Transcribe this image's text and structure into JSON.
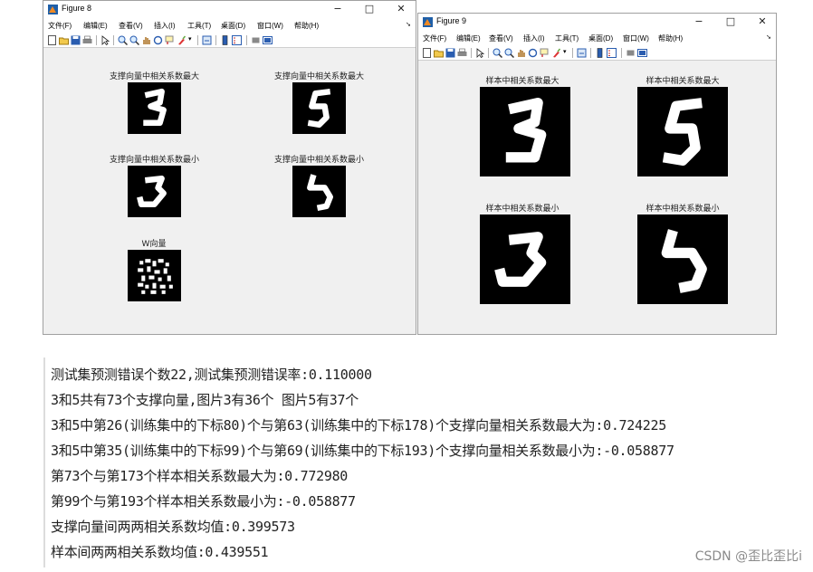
{
  "windows": [
    {
      "title": "Figure 8",
      "controls": [
        "−",
        "□",
        "✕"
      ],
      "menu": [
        "文件(F)",
        "编辑(E)",
        "查看(V)",
        "插入(I)",
        "工具(T)",
        "桌面(D)",
        "窗口(W)",
        "帮助(H)"
      ],
      "subplots": [
        {
          "title": "支撑向量中相关系数最大",
          "digit": "3"
        },
        {
          "title": "支撑向量中相关系数最大",
          "digit": "5"
        },
        {
          "title": "支撑向量中相关系数最小",
          "digit": "3"
        },
        {
          "title": "支撑向量中相关系数最小",
          "digit": "5"
        },
        {
          "title": "W向量",
          "digit": "W"
        }
      ]
    },
    {
      "title": "Figure 9",
      "controls": [
        "−",
        "□",
        "✕"
      ],
      "menu": [
        "文件(F)",
        "编辑(E)",
        "查看(V)",
        "插入(I)",
        "工具(T)",
        "桌面(D)",
        "窗口(W)",
        "帮助(H)"
      ],
      "subplots": [
        {
          "title": "样本中相关系数最大",
          "digit": "3"
        },
        {
          "title": "样本中相关系数最大",
          "digit": "5"
        },
        {
          "title": "样本中相关系数最小",
          "digit": "3"
        },
        {
          "title": "样本中相关系数最小",
          "digit": "5"
        }
      ]
    }
  ],
  "console": {
    "lines": [
      "测试集预测错误个数22,测试集预测错误率:0.110000",
      "3和5共有73个支撑向量,图片3有36个 图片5有37个",
      "3和5中第26(训练集中的下标80)个与第63(训练集中的下标178)个支撑向量相关系数最大为:0.724225",
      "3和5中第35(训练集中的下标99)个与第69(训练集中的下标193)个支撑向量相关系数最小为:-0.058877",
      "第73个与第173个样本相关系数最大为:0.772980",
      "第99个与第193个样本相关系数最小为:-0.058877",
      "支撑向量间两两相关系数均值:0.399573",
      "样本间两两相关系数均值:0.439551"
    ]
  },
  "watermark": "CSDN @歪比歪比i",
  "icons": {
    "toolbar": [
      "new-figure-icon",
      "open-icon",
      "save-icon",
      "print-icon",
      "pointer-icon",
      "zoom-in-icon",
      "zoom-out-icon",
      "pan-icon",
      "rotate-icon",
      "data-cursor-icon",
      "brush-icon",
      "link-icon",
      "colorbar-icon",
      "legend-icon",
      "hide-plot-tools-icon",
      "show-plot-tools-icon"
    ]
  }
}
